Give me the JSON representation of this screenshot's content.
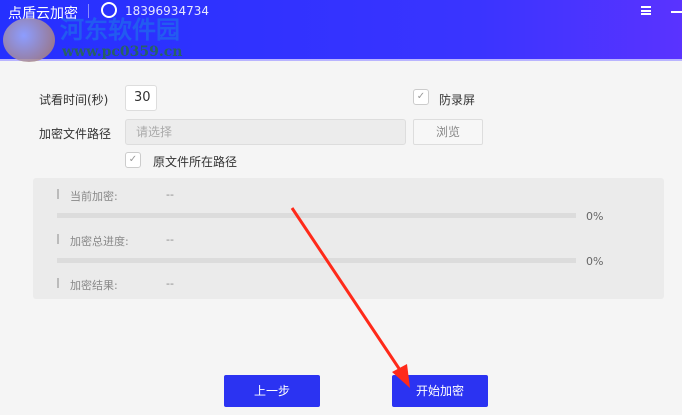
{
  "header": {
    "title": "点盾云加密",
    "phone": "18396934734"
  },
  "watermark": {
    "text": "河东软件园",
    "url": "www.pc0359.cn"
  },
  "form": {
    "trial_label": "试看时间(秒)",
    "trial_value": "30",
    "anti_record_label": "防录屏",
    "anti_record_checked": true,
    "path_label": "加密文件路径",
    "path_placeholder": "请选择",
    "browse_label": "浏览",
    "orig_path_label": "原文件所在路径",
    "orig_path_checked": true
  },
  "progress": {
    "current_label": "当前加密:",
    "current_value": "--",
    "current_percent": "0%",
    "total_label": "加密总进度:",
    "total_value": "--",
    "total_percent": "0%",
    "result_label": "加密结果:",
    "result_value": "--"
  },
  "buttons": {
    "prev": "上一步",
    "start": "开始加密"
  },
  "colors": {
    "accent": "#2b33f2",
    "arrow": "#ff2a1a"
  }
}
